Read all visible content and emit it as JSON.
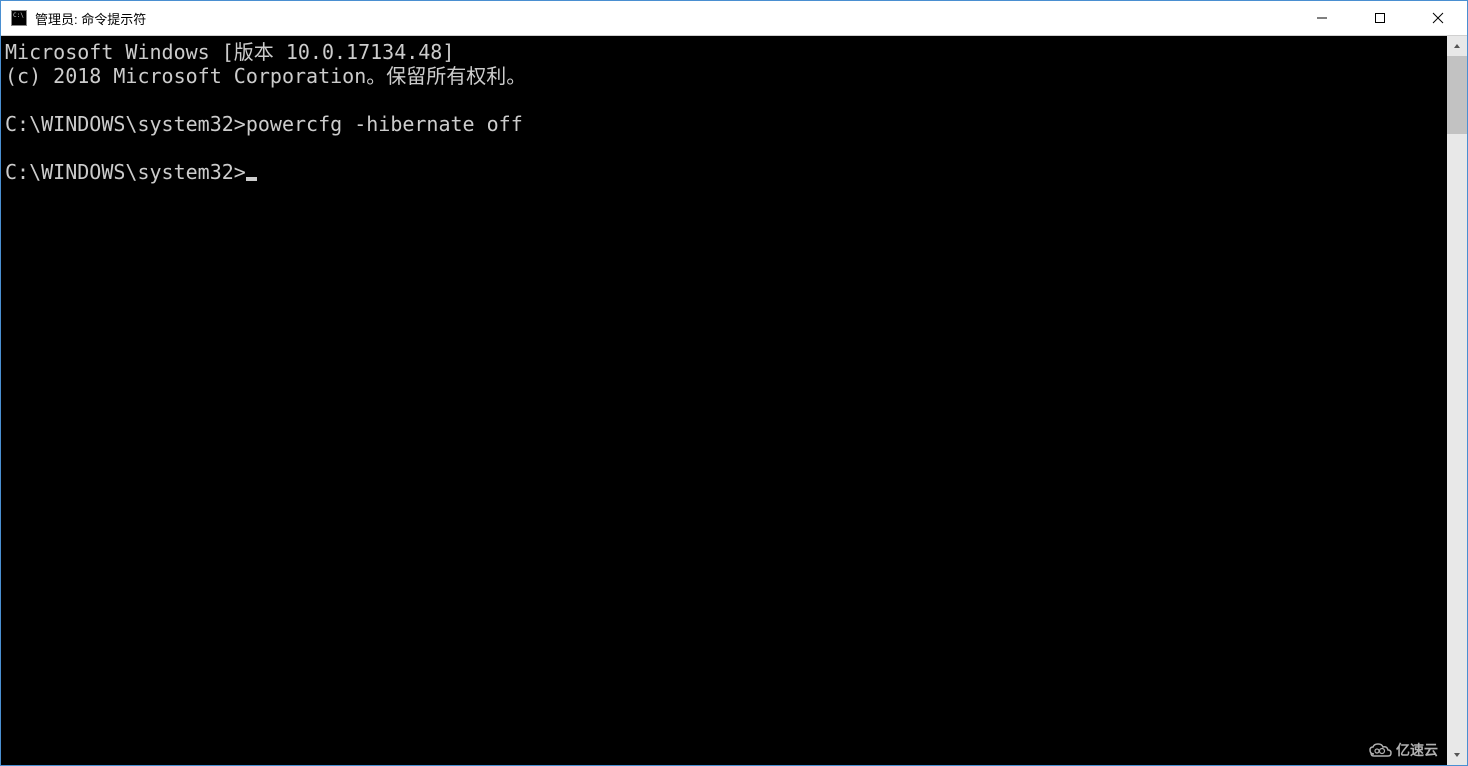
{
  "window": {
    "title": "管理员: 命令提示符"
  },
  "terminal": {
    "lines": [
      "Microsoft Windows [版本 10.0.17134.48]",
      "(c) 2018 Microsoft Corporation。保留所有权利。",
      "",
      "C:\\WINDOWS\\system32>powercfg -hibernate off",
      ""
    ],
    "current_prompt": "C:\\WINDOWS\\system32>"
  },
  "watermark": {
    "text": "亿速云"
  }
}
